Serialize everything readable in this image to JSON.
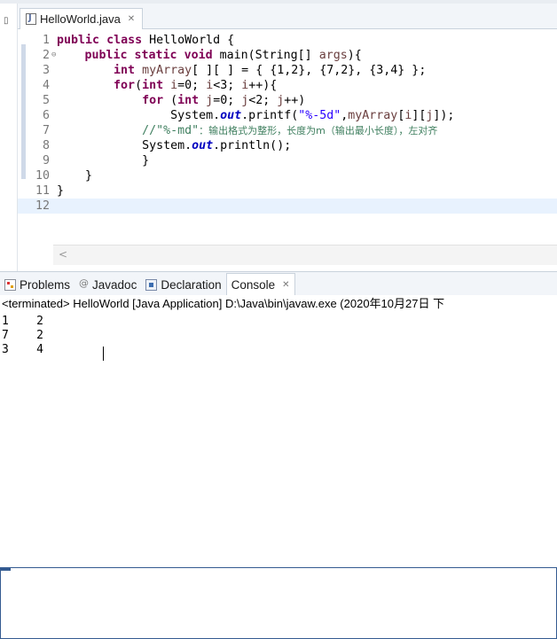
{
  "editor": {
    "tab": {
      "filename": "HelloWorld.java",
      "close_glyph": "✕"
    },
    "lines": [
      {
        "n": "1",
        "segments": [
          {
            "t": "public",
            "c": "kw"
          },
          {
            "t": " "
          },
          {
            "t": "class",
            "c": "kw"
          },
          {
            "t": " HelloWorld {"
          }
        ]
      },
      {
        "n": "2",
        "fold": "⊖",
        "segments": [
          {
            "t": "    "
          },
          {
            "t": "public",
            "c": "kw"
          },
          {
            "t": " "
          },
          {
            "t": "static",
            "c": "kw"
          },
          {
            "t": " "
          },
          {
            "t": "void",
            "c": "kw"
          },
          {
            "t": " main(String[] "
          },
          {
            "t": "args",
            "c": "var"
          },
          {
            "t": "){"
          }
        ]
      },
      {
        "n": "3",
        "segments": [
          {
            "t": "        "
          },
          {
            "t": "int",
            "c": "kw"
          },
          {
            "t": " "
          },
          {
            "t": "myArray",
            "c": "var"
          },
          {
            "t": "[ ][ ] = { {1,2}, {7,2}, {3,4} };"
          }
        ]
      },
      {
        "n": "4",
        "segments": [
          {
            "t": "        "
          },
          {
            "t": "for",
            "c": "kw"
          },
          {
            "t": "("
          },
          {
            "t": "int",
            "c": "kw"
          },
          {
            "t": " "
          },
          {
            "t": "i",
            "c": "var"
          },
          {
            "t": "=0; "
          },
          {
            "t": "i",
            "c": "var"
          },
          {
            "t": "<3; "
          },
          {
            "t": "i",
            "c": "var"
          },
          {
            "t": "++){"
          }
        ]
      },
      {
        "n": "5",
        "segments": [
          {
            "t": "            "
          },
          {
            "t": "for",
            "c": "kw"
          },
          {
            "t": " ("
          },
          {
            "t": "int",
            "c": "kw"
          },
          {
            "t": " "
          },
          {
            "t": "j",
            "c": "var"
          },
          {
            "t": "=0; "
          },
          {
            "t": "j",
            "c": "var"
          },
          {
            "t": "<2; "
          },
          {
            "t": "j",
            "c": "var"
          },
          {
            "t": "++)"
          }
        ]
      },
      {
        "n": "6",
        "segments": [
          {
            "t": "                System."
          },
          {
            "t": "out",
            "c": "fld"
          },
          {
            "t": ".printf("
          },
          {
            "t": "\"%-5d\"",
            "c": "str"
          },
          {
            "t": ","
          },
          {
            "t": "myArray",
            "c": "var"
          },
          {
            "t": "["
          },
          {
            "t": "i",
            "c": "var"
          },
          {
            "t": "]["
          },
          {
            "t": "j",
            "c": "var"
          },
          {
            "t": "]);"
          }
        ]
      },
      {
        "n": "7",
        "segments": [
          {
            "t": "            "
          },
          {
            "t": "//\"%-md\"",
            "c": "cmt"
          },
          {
            "t": "：输出格式为整形，长度为m（输出最小长度），左对齐",
            "c": "cmt-cjk"
          }
        ]
      },
      {
        "n": "8",
        "segments": [
          {
            "t": "            System."
          },
          {
            "t": "out",
            "c": "fld"
          },
          {
            "t": ".println();"
          }
        ]
      },
      {
        "n": "9",
        "segments": [
          {
            "t": "            }"
          }
        ]
      },
      {
        "n": "10",
        "segments": [
          {
            "t": "    }"
          }
        ]
      },
      {
        "n": "11",
        "segments": [
          {
            "t": "}"
          }
        ]
      },
      {
        "n": "12",
        "segments": [
          {
            "t": ""
          }
        ]
      }
    ]
  },
  "views": {
    "tabs": [
      {
        "label": "Problems",
        "icon": "problems-icon"
      },
      {
        "label": "Javadoc",
        "icon": "javadoc-icon"
      },
      {
        "label": "Declaration",
        "icon": "declaration-icon"
      },
      {
        "label": "Console",
        "icon": "console-icon",
        "active": true,
        "close_glyph": "✕"
      }
    ]
  },
  "console": {
    "header": "<terminated> HelloWorld [Java Application] D:\\Java\\bin\\javaw.exe  (2020年10月27日 下",
    "output": [
      "1    2",
      "7    2",
      "3    4"
    ]
  },
  "scroll_left_glyph": "<"
}
